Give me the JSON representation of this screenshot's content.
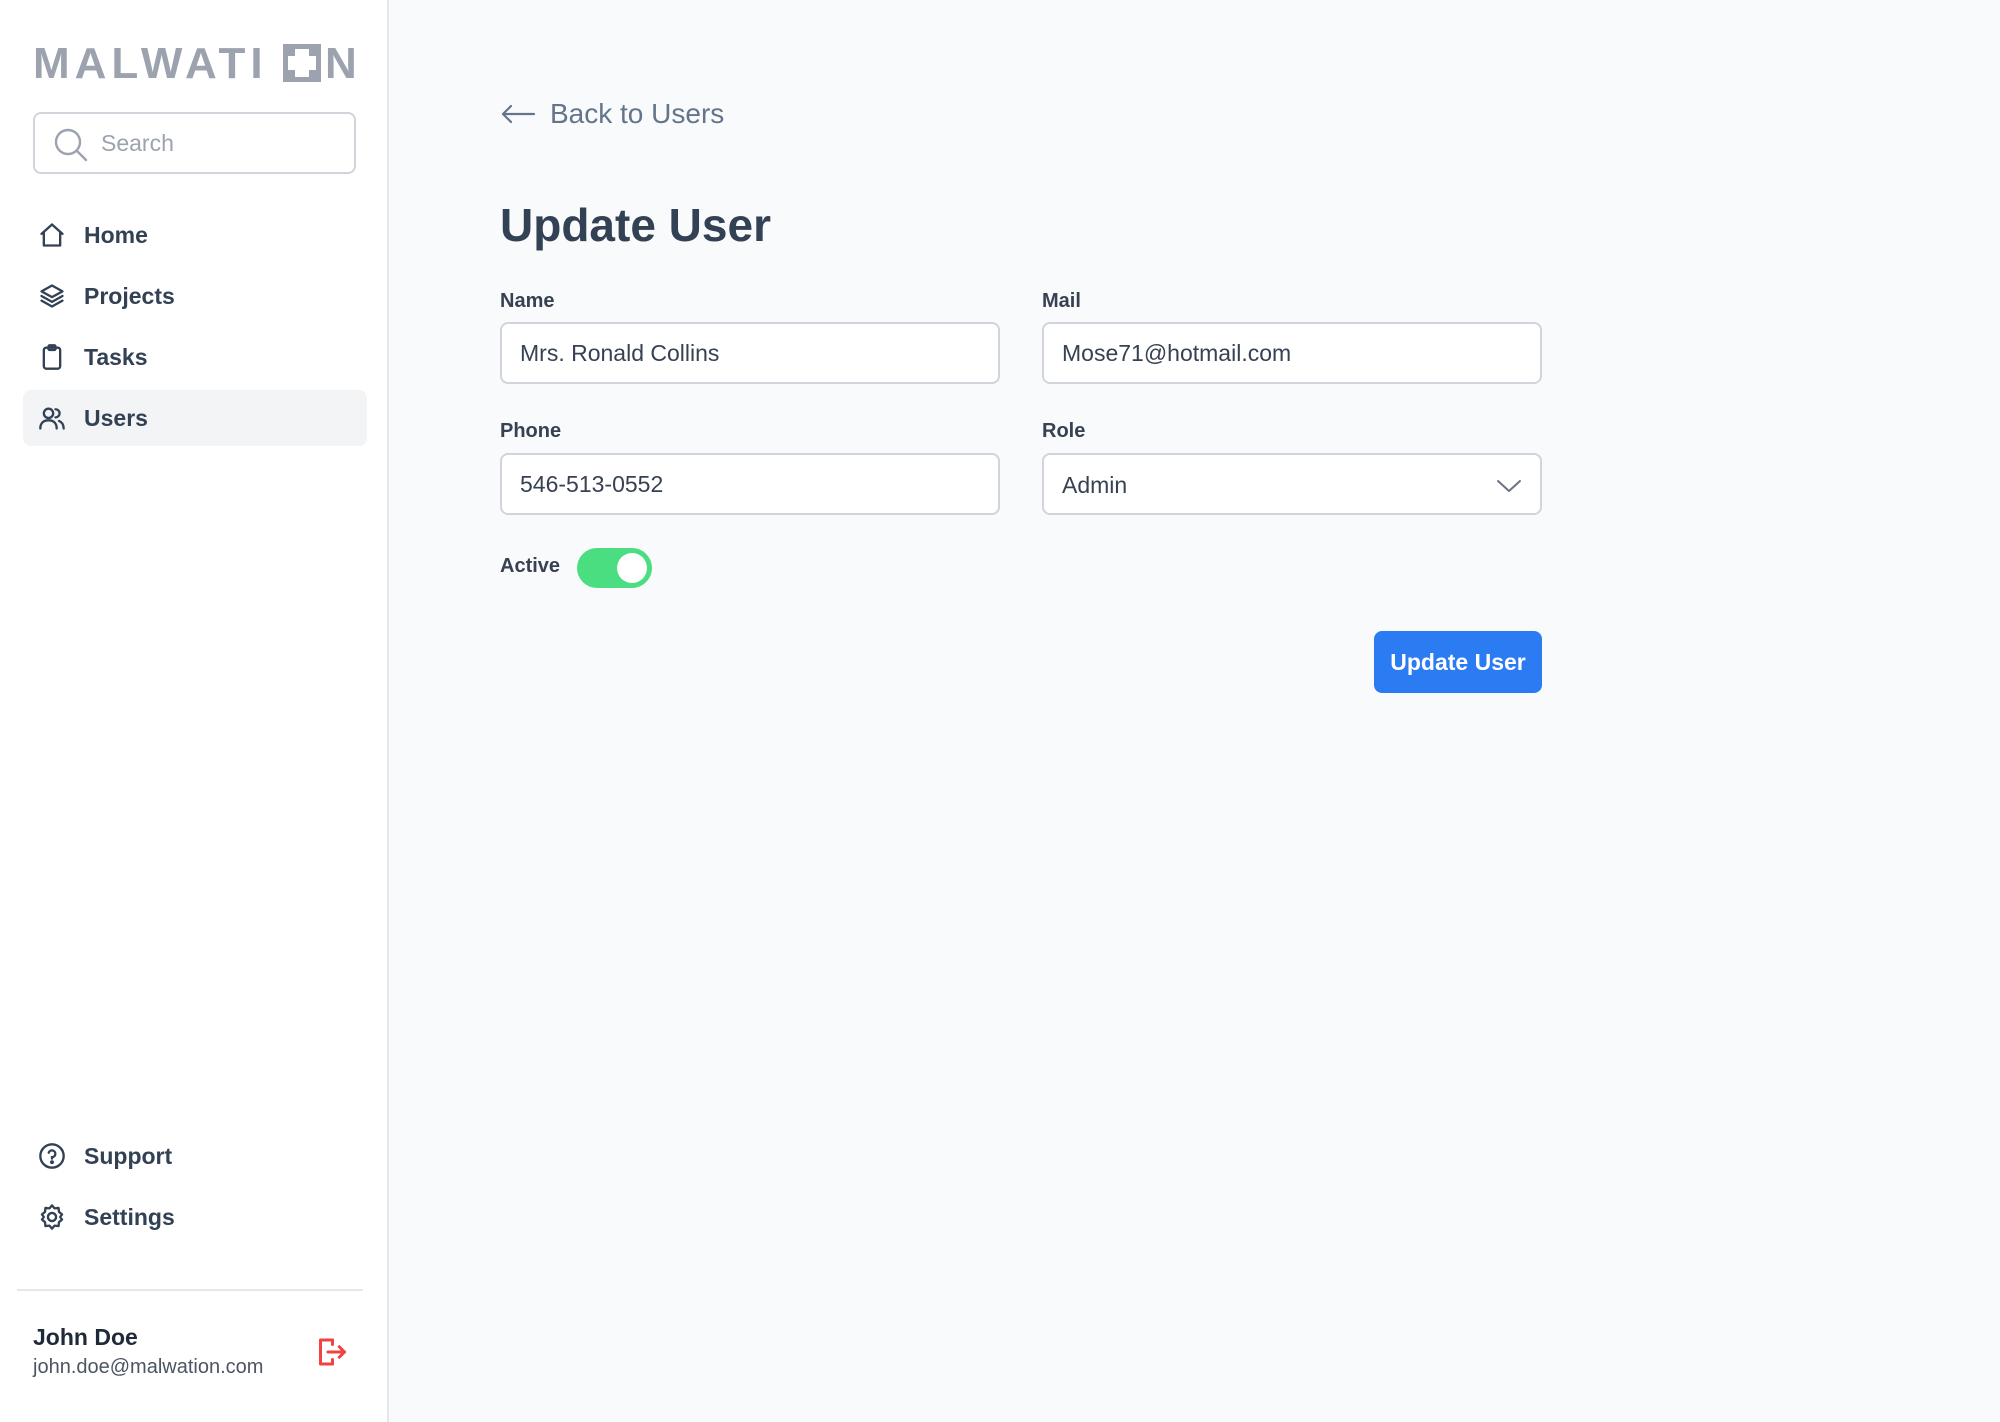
{
  "brand": {
    "logo_text": "MALWATION"
  },
  "search": {
    "placeholder": "Search",
    "value": ""
  },
  "nav": {
    "items": [
      {
        "label": "Home",
        "icon": "home-icon",
        "active": false
      },
      {
        "label": "Projects",
        "icon": "layers-icon",
        "active": false
      },
      {
        "label": "Tasks",
        "icon": "clipboard-icon",
        "active": false
      },
      {
        "label": "Users",
        "icon": "users-icon",
        "active": true
      }
    ],
    "bottom_items": [
      {
        "label": "Support",
        "icon": "help-circle-icon"
      },
      {
        "label": "Settings",
        "icon": "gear-icon"
      }
    ]
  },
  "user": {
    "name": "John Doe",
    "email": "john.doe@malwation.com",
    "logout_icon": "logout-icon"
  },
  "main": {
    "back_label": "Back to Users",
    "title": "Update User",
    "form": {
      "name": {
        "label": "Name",
        "value": "Mrs. Ronald Collins"
      },
      "mail": {
        "label": "Mail",
        "value": "Mose71@hotmail.com"
      },
      "phone": {
        "label": "Phone",
        "value": "546-513-0552"
      },
      "role": {
        "label": "Role",
        "value": "Admin"
      },
      "active": {
        "label": "Active",
        "checked": true
      },
      "submit_label": "Update User"
    }
  },
  "colors": {
    "accent": "#2b7cf2",
    "toggle_on": "#4ade80",
    "logout": "#ef4444",
    "logo": "#9ca3af"
  }
}
